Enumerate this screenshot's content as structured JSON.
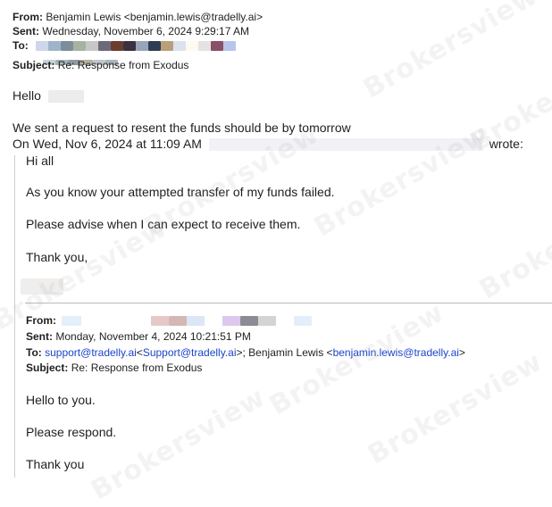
{
  "headers": {
    "from_label": "From:",
    "from_value": "Benjamin Lewis <benjamin.lewis@tradelly.ai>",
    "sent_label": "Sent:",
    "sent_value": "Wednesday, November 6, 2024 9:29:17 AM",
    "to_label": "To:",
    "subject_label": "Subject:",
    "subject_value": "Re: Response from Exodus"
  },
  "message": {
    "greeting": "Hello",
    "line1": "We sent a request to resent the funds should be by tomorrow",
    "quote_intro": "On Wed, Nov 6, 2024 at 11:09 AM",
    "quote_wrote": "wrote:"
  },
  "quoted": {
    "greeting": "Hi all",
    "line1": "As you know your attempted transfer of my funds failed.",
    "line2": "Please advise when I can expect to receive them.",
    "closing": "Thank you,"
  },
  "quoted_headers": {
    "from_label": "From:",
    "sent_label": "Sent:",
    "sent_value": "Monday, November 4, 2024 10:21:51 PM",
    "to_label": "To:",
    "to_link1": "support@tradelly.ai",
    "to_text1": "<",
    "to_link2": "Support@tradelly.ai",
    "to_text2": ">; Benjamin Lewis <",
    "to_link3": "benjamin.lewis@tradelly.ai",
    "to_text3": ">",
    "subject_label": "Subject:",
    "subject_value": "Re: Response from Exodus"
  },
  "quoted2": {
    "line1": "Hello to you.",
    "line2": "Please respond.",
    "line3": "Thank you"
  },
  "watermark": "Brokersview",
  "colors": {
    "link": "#1a45c9",
    "text": "#1f1f1f",
    "separator": "#b9b9b9"
  }
}
